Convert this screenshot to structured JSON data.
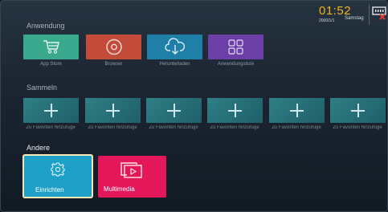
{
  "status": {
    "time": "01:52",
    "date": "2000/1/1",
    "weekday": "Samstag",
    "network_icon": "ethernet-disconnected-icon"
  },
  "sections": {
    "apps_title": "Anwendung",
    "favorites_title": "Sammeln",
    "other_title": "Andere"
  },
  "apps": [
    {
      "label": "App Store",
      "icon": "shopping-cart-icon",
      "color": "#3aa88c"
    },
    {
      "label": "Browser",
      "icon": "browser-icon",
      "color": "#c44a3a"
    },
    {
      "label": "Herunterladen",
      "icon": "cloud-download-icon",
      "color": "#1f7fa6"
    },
    {
      "label": "Anwendungsliste",
      "icon": "app-grid-icon",
      "color": "#6c3fa6"
    }
  ],
  "favorites": [
    {
      "label": "Zu Favoriten hinzufüge"
    },
    {
      "label": "Zu Favoriten hinzufüge"
    },
    {
      "label": "Zu Favoriten hinzufüge"
    },
    {
      "label": "Zu Favoriten hinzufüge"
    },
    {
      "label": "Zu Favoriten hinzufüge"
    },
    {
      "label": "Zu Favoriten hinzufüge"
    }
  ],
  "other": [
    {
      "label": "Einrichten",
      "icon": "gear-icon",
      "color": "#1ea0c8"
    },
    {
      "label": "Multimedia",
      "icon": "play-screen-icon",
      "color": "#e4175a"
    }
  ]
}
